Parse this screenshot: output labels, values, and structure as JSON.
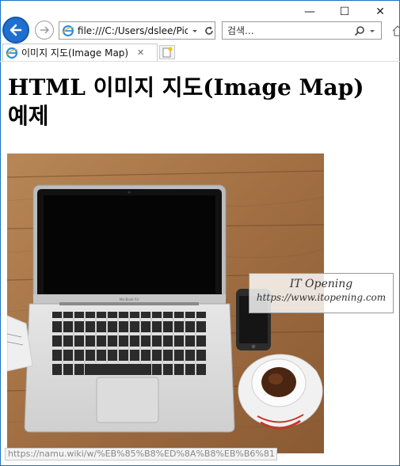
{
  "window": {
    "minimize_glyph": "—",
    "maximize_glyph": "☐",
    "close_glyph": "✕"
  },
  "nav": {
    "address": "file:///C:/Users/dslee/Pictu",
    "search_placeholder": "검색..."
  },
  "tab": {
    "label": "이미지 지도(Image Map) <...",
    "close_glyph": "✕"
  },
  "page": {
    "heading": "HTML 이미지 지도(Image Map) 예제"
  },
  "image": {
    "laptop_brand": "MacBook Air",
    "watermark_title": "IT Opening",
    "watermark_url": "https://www.itopening.com"
  },
  "status_bar": {
    "url": "https://namu.wiki/w/%EB%85%B8%ED%8A%B8%EB%B6%81"
  },
  "colors": {
    "accent": "#1e6fd0",
    "table_wood": "#a9774a",
    "ie_icon": "#2a8fe0"
  }
}
